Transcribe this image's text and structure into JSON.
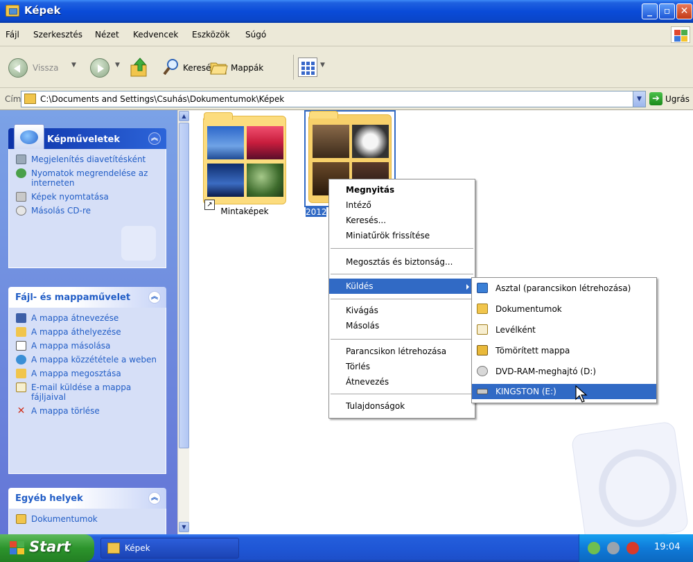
{
  "window": {
    "title": "Képek"
  },
  "menu": [
    "Fájl",
    "Szerkesztés",
    "Nézet",
    "Kedvencek",
    "Eszközök",
    "Súgó"
  ],
  "toolbar": {
    "back": "Vissza",
    "search": "Keresés",
    "folders": "Mappák"
  },
  "address": {
    "label": "Cím",
    "path": "C:\\Documents and Settings\\Csuhás\\Dokumentumok\\Képek",
    "go": "Ugrás"
  },
  "taskpane": {
    "picture_tasks": {
      "title": "Képműveletek",
      "items": [
        "Megjelenítés diavetítésként",
        "Nyomatok megrendelése az interneten",
        "Képek nyomtatása",
        "Másolás CD-re"
      ]
    },
    "file_tasks": {
      "title": "Fájl- és mappaművelet",
      "items": [
        "A mappa átnevezése",
        "A mappa áthelyezése",
        "A mappa másolása",
        "A mappa közzététele a weben",
        "A mappa megosztása",
        "E-mail küldése a mappa fájljaival",
        "A mappa törlése"
      ]
    },
    "other_places": {
      "title": "Egyéb helyek",
      "items": [
        "Dokumentumok"
      ]
    }
  },
  "folders": [
    {
      "name": "Mintaképek"
    },
    {
      "name": "2012"
    }
  ],
  "context_menu": {
    "items": [
      "Megnyitás",
      "Intéző",
      "Keresés...",
      "Miniatűrök frissítése",
      "Megosztás és biztonság...",
      "Küldés",
      "Kivágás",
      "Másolás",
      "Parancsikon létrehozása",
      "Törlés",
      "Átnevezés",
      "Tulajdonságok"
    ]
  },
  "sendto_menu": {
    "items": [
      "Asztal (parancsikon létrehozása)",
      "Dokumentumok",
      "Levélként",
      "Tömörített mappa",
      "DVD-RAM-meghajtó (D:)",
      "KINGSTON (E:)"
    ]
  },
  "taskbar": {
    "start": "Start",
    "window_button": "Képek",
    "clock": "19:04"
  },
  "colors": {
    "selection": "#316ac5",
    "titlebar": "#0a4bd8",
    "taskbar": "#245edb",
    "start": "#2c942c"
  }
}
